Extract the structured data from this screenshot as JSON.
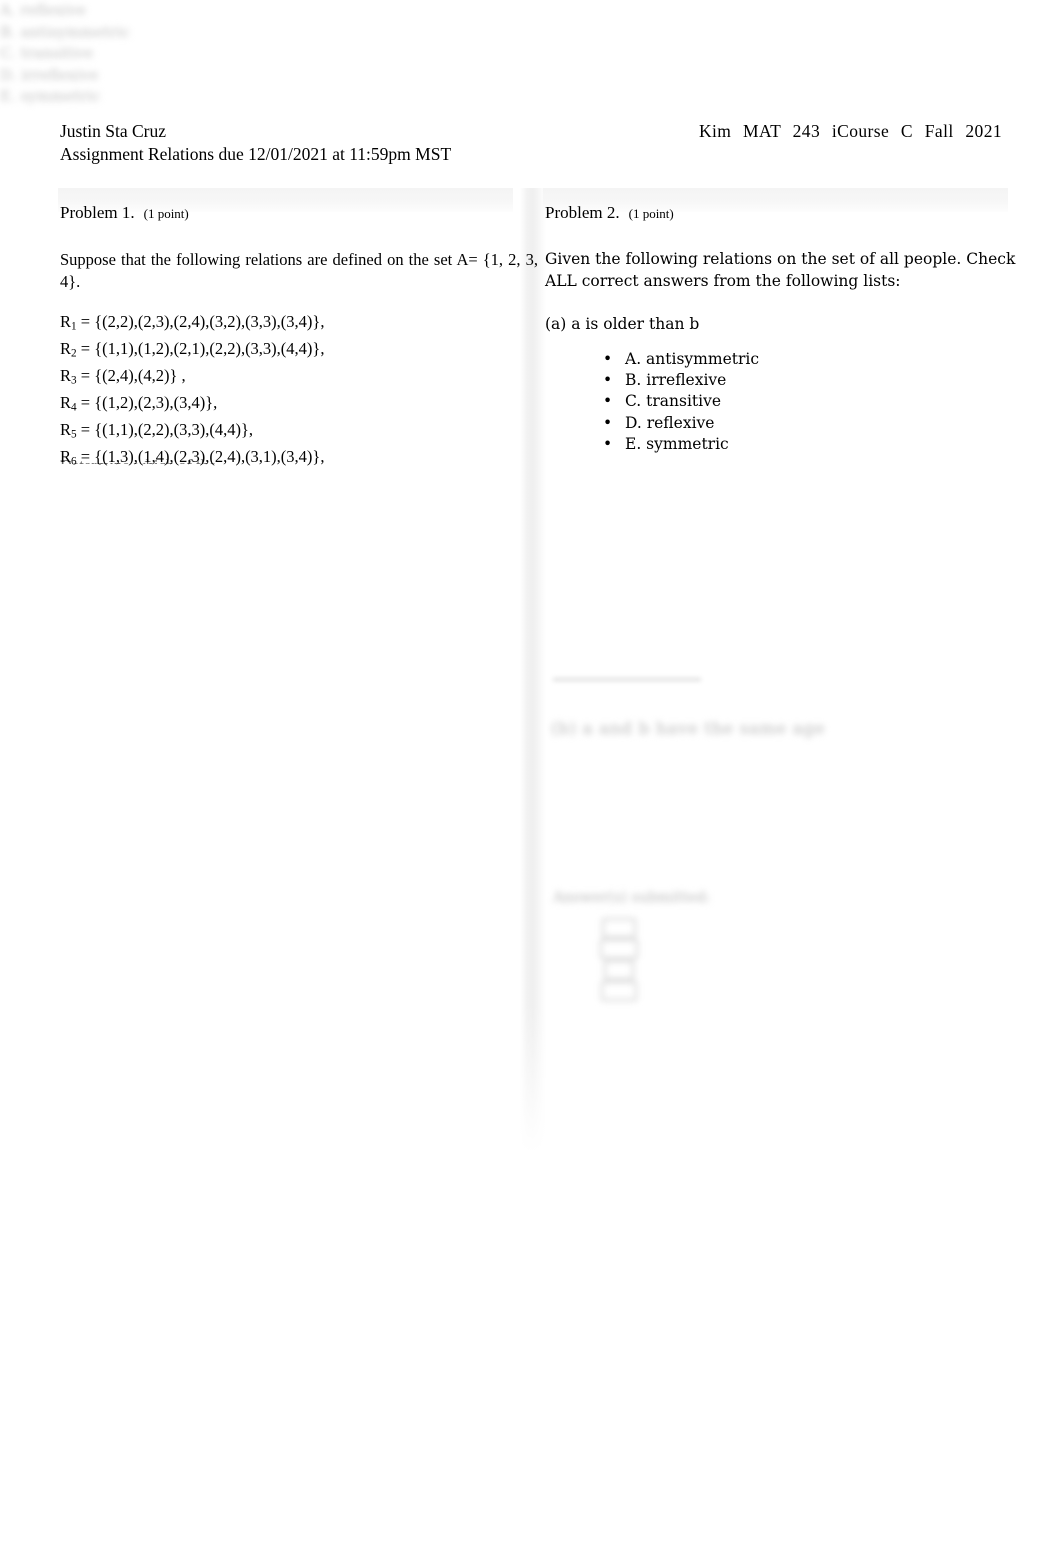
{
  "header": {
    "student_name": "Justin Sta Cruz",
    "assignment_line": "Assignment Relations due 12/01/2021 at 11:59pm MST",
    "course_parts": [
      "Kim",
      "MAT",
      "243",
      "iCourse",
      "C",
      "Fall",
      "2021"
    ]
  },
  "problem1": {
    "title": "Problem 1.",
    "points": "(1 point)",
    "body": "Suppose that the following relations are defined on the set A=  {1, 2, 3, 4}.",
    "relations": [
      {
        "name": "R",
        "sub": "1",
        "eq": "=",
        "value": "{(2,2),(2,3),(2,4),(3,2),(3,3),(3,4)},"
      },
      {
        "name": "R",
        "sub": "2",
        "eq": "=",
        "value": "{(1,1),(1,2),(2,1),(2,2),(3,3),(4,4)},"
      },
      {
        "name": "R",
        "sub": "3",
        "eq": "=",
        "value": "{(2,4),(4,2)} ,"
      },
      {
        "name": "R",
        "sub": "4",
        "eq": "=",
        "value": "{(1,2),(2,3),(3,4)},"
      },
      {
        "name": "R",
        "sub": "5",
        "eq": "=",
        "value": "{(1,1),(2,2),(3,3),(4,4)},"
      },
      {
        "name": "R",
        "sub": "6",
        "eq": "=",
        "value": "{(1,3),(1,4),(2,3),(2,4),(3,1),(3,4)},"
      }
    ],
    "clipped_line": "Determine which of the"
  },
  "problem2": {
    "title": "Problem 2.",
    "points": "(1 point)",
    "body": "Given the following relations on the set of all people. Check ALL correct answers from the following lists:",
    "sub_question": "(a) a is older than b",
    "options": [
      {
        "bullet": "•",
        "label": "A. antisymmetric"
      },
      {
        "bullet": "•",
        "label": "B. irreflexive"
      },
      {
        "bullet": "•",
        "label": "C. transitive"
      },
      {
        "bullet": "•",
        "label": "D. reflexive"
      },
      {
        "bullet": "•",
        "label": "E. symmetric"
      }
    ]
  },
  "ghost": {
    "heading": "(b) a and b have the same age",
    "items": [
      "A. reflexive",
      "B. antisymmetric",
      "C. transitive",
      "D. irreflexive",
      "E. symmetric"
    ],
    "label": "Answer(s) submitted:"
  }
}
